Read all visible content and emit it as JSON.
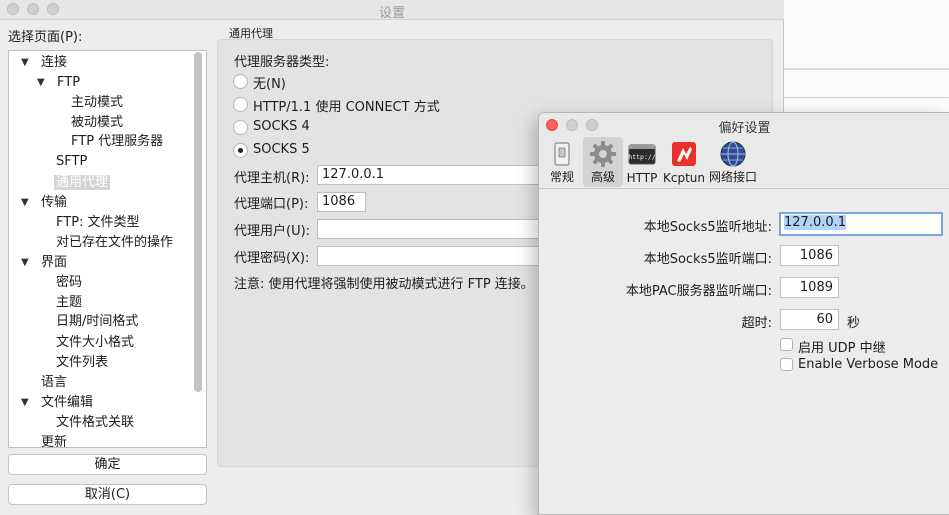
{
  "main_window": {
    "title": "设置",
    "select_page_label": "选择页面(P):",
    "tree": [
      {
        "label": "连接",
        "arrow": "▼"
      },
      {
        "label": "FTP",
        "arrow": "▼"
      },
      {
        "label": "主动模式",
        "arrow": ""
      },
      {
        "label": "被动模式",
        "arrow": ""
      },
      {
        "label": "FTP 代理服务器",
        "arrow": ""
      },
      {
        "label": "SFTP",
        "arrow": ""
      },
      {
        "label": "通用代理",
        "arrow": ""
      },
      {
        "label": "传输",
        "arrow": "▼"
      },
      {
        "label": "FTP: 文件类型",
        "arrow": ""
      },
      {
        "label": "对已存在文件的操作",
        "arrow": ""
      },
      {
        "label": "界面",
        "arrow": "▼"
      },
      {
        "label": "密码",
        "arrow": ""
      },
      {
        "label": "主题",
        "arrow": ""
      },
      {
        "label": "日期/时间格式",
        "arrow": ""
      },
      {
        "label": "文件大小格式",
        "arrow": ""
      },
      {
        "label": "文件列表",
        "arrow": ""
      },
      {
        "label": "语言",
        "arrow": ""
      },
      {
        "label": "文件编辑",
        "arrow": "▼"
      },
      {
        "label": "文件格式关联",
        "arrow": ""
      },
      {
        "label": "更新",
        "arrow": ""
      }
    ],
    "ok_button": "确定",
    "cancel_button": "取消(C)",
    "group_title": "通用代理",
    "proxy_type_label": "代理服务器类型:",
    "proxy_options": [
      "无(N)",
      "HTTP/1.1 使用 CONNECT 方式",
      "SOCKS 4",
      "SOCKS 5"
    ],
    "selected_proxy": "SOCKS 5",
    "host_label": "代理主机(R):",
    "host_value": "127.0.0.1",
    "port_label": "代理端口(P):",
    "port_value": "1086",
    "user_label": "代理用户(U):",
    "user_value": "",
    "password_label": "代理密码(X):",
    "password_value": "",
    "note": "注意: 使用代理将强制使用被动模式进行 FTP 连接。"
  },
  "pref_window": {
    "title": "偏好设置",
    "tabs": [
      {
        "label": "常规",
        "icon": "switch-icon"
      },
      {
        "label": "高级",
        "icon": "gear-icon"
      },
      {
        "label": "HTTP",
        "icon": "http-terminal-icon"
      },
      {
        "label": "Kcptun",
        "icon": "kcptun-icon"
      },
      {
        "label": "网络接口",
        "icon": "network-globe-icon"
      }
    ],
    "active_tab": "高级",
    "socks5_addr_label": "本地Socks5监听地址:",
    "socks5_addr_value": "127.0.0.1",
    "socks5_port_label": "本地Socks5监听端口:",
    "socks5_port_value": "1086",
    "pac_port_label": "本地PAC服务器监听端口:",
    "pac_port_value": "1089",
    "timeout_label": "超时:",
    "timeout_value": "60",
    "timeout_unit": "秒",
    "udp_relay_label": "启用 UDP 中继",
    "udp_relay_checked": false,
    "verbose_label": "Enable Verbose Mode",
    "verbose_checked": false
  },
  "colors": {
    "close_red": "#fd5e57",
    "focus_blue": "#7aa7e4",
    "selection_blue": "#b3d2f7",
    "selected_tree_bg": "#d5d5d5"
  }
}
